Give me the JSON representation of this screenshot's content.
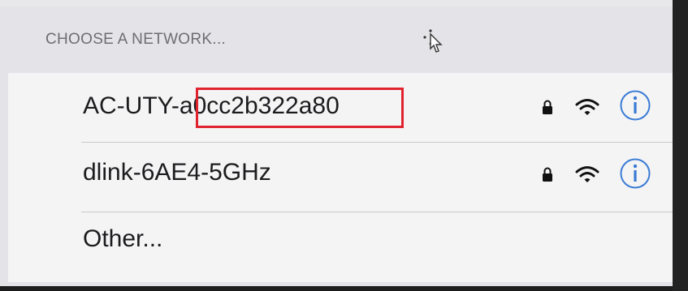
{
  "section": {
    "header": "CHOOSE A NETWORK..."
  },
  "networks": [
    {
      "name_prefix": "AC-UTY-",
      "name_suffix": "a0cc2b322a80",
      "secured": true,
      "icons": [
        "lock-icon",
        "wifi-icon",
        "info-icon"
      ],
      "highlighted": true,
      "highlight_color": "#e0232e"
    },
    {
      "name": "dlink-6AE4-5GHz",
      "secured": true,
      "icons": [
        "lock-icon",
        "wifi-icon",
        "info-icon"
      ]
    },
    {
      "name": "Other..."
    }
  ],
  "colors": {
    "accent": "#3a7bd5",
    "highlight": "#e0232e",
    "header_text": "#6e6e72",
    "row_background": "#f4f4f5",
    "screen_background": "#e4e3e8"
  }
}
